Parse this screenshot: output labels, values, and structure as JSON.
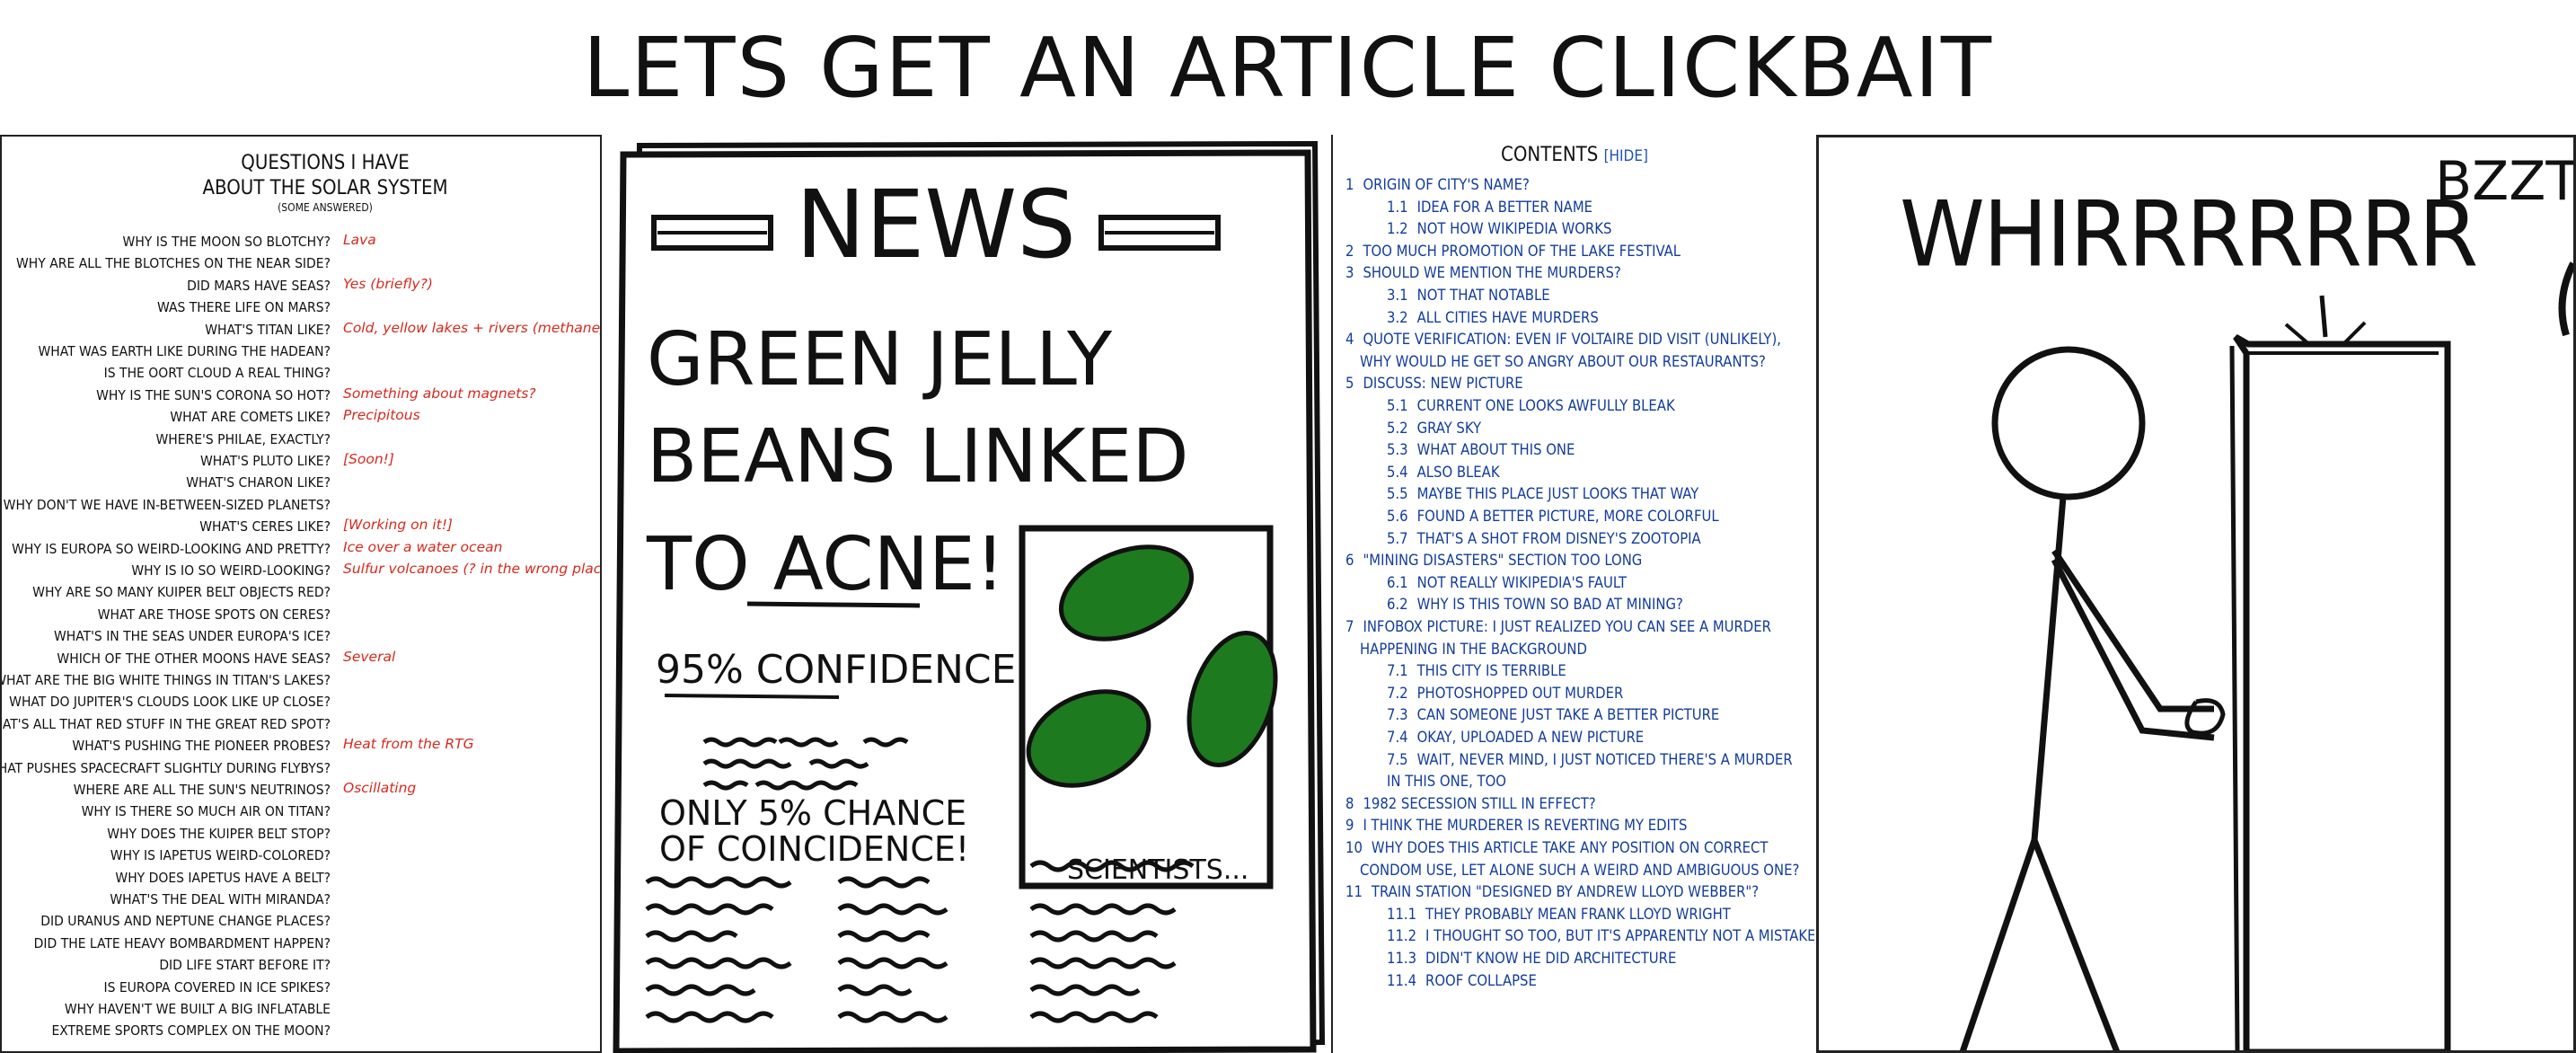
{
  "title": "LETS GET AN ARTICLE CLICKBAIT",
  "panel1": {
    "heading_line1": "QUESTIONS I HAVE",
    "heading_line2": "ABOUT THE SOLAR SYSTEM",
    "subheading": "(SOME ANSWERED)",
    "questions": [
      "WHY IS THE MOON SO BLOTCHY?",
      "WHY ARE ALL THE BLOTCHES ON THE NEAR SIDE?",
      "DID MARS HAVE SEAS?",
      "WAS THERE LIFE ON MARS?",
      "WHAT'S TITAN LIKE?",
      "WHAT WAS EARTH LIKE DURING THE HADEAN?",
      "IS THE OORT CLOUD A REAL THING?",
      "WHY IS THE SUN'S CORONA SO HOT?",
      "WHAT ARE COMETS LIKE?",
      "WHERE'S PHILAE, EXACTLY?",
      "WHAT'S PLUTO LIKE?",
      "WHAT'S CHARON LIKE?",
      "WHY DON'T WE HAVE IN-BETWEEN-SIZED PLANETS?",
      "WHAT'S CERES LIKE?",
      "WHY IS EUROPA SO WEIRD-LOOKING AND PRETTY?",
      "WHY IS IO SO WEIRD-LOOKING?",
      "WHY ARE SO MANY KUIPER BELT OBJECTS RED?",
      "WHAT ARE THOSE SPOTS ON CERES?",
      "WHAT'S IN THE SEAS UNDER EUROPA'S ICE?",
      "WHICH OF THE OTHER MOONS HAVE SEAS?",
      "WHAT ARE THE BIG WHITE THINGS IN TITAN'S LAKES?",
      "WHAT DO JUPITER'S CLOUDS LOOK LIKE UP CLOSE?",
      "WHAT'S ALL THAT RED STUFF IN THE GREAT RED SPOT?",
      "WHAT'S PUSHING THE PIONEER PROBES?",
      "WHAT PUSHES SPACECRAFT SLIGHTLY DURING FLYBYS?",
      "WHERE ARE ALL THE SUN'S NEUTRINOS?",
      "WHY IS THERE SO MUCH AIR ON TITAN?",
      "WHY DOES THE KUIPER BELT STOP?",
      "WHY IS IAPETUS WEIRD-COLORED?",
      "WHY DOES IAPETUS HAVE A BELT?",
      "WHAT'S THE DEAL WITH MIRANDA?",
      "DID URANUS AND NEPTUNE CHANGE PLACES?",
      "DID THE LATE HEAVY BOMBARDMENT HAPPEN?",
      "DID LIFE START BEFORE IT?",
      "IS EUROPA COVERED IN ICE SPIKES?",
      "WHY HAVEN'T WE BUILT A BIG INFLATABLE",
      "EXTREME SPORTS COMPLEX ON THE MOON?"
    ],
    "answers": [
      {
        "row": 0,
        "text": "Lava"
      },
      {
        "row": 2,
        "text": "Yes (briefly?)"
      },
      {
        "row": 4,
        "text": "Cold, yellow lakes + rivers (methane)"
      },
      {
        "row": 7,
        "text": "Something about magnets?"
      },
      {
        "row": 8,
        "text": "Precipitous"
      },
      {
        "row": 10,
        "text": "[Soon!]"
      },
      {
        "row": 13,
        "text": "[Working on it!]"
      },
      {
        "row": 14,
        "text": "Ice over a water ocean"
      },
      {
        "row": 15,
        "text": "Sulfur volcanoes (? in the wrong places?)"
      },
      {
        "row": 19,
        "text": "Several"
      },
      {
        "row": 23,
        "text": "Heat from the RTG"
      },
      {
        "row": 25,
        "text": "Oscillating"
      }
    ]
  },
  "panel2": {
    "masthead": "NEWS",
    "headline_line1": "GREEN JELLY",
    "headline_line2": "BEANS LINKED",
    "headline_line3": "TO ACNE!",
    "confidence": "95% CONFIDENCE",
    "chance_line1": "ONLY 5% CHANCE",
    "chance_line2": "OF COINCIDENCE!",
    "scientists": "SCIENTISTS...",
    "jellybean_color": "#1e7a1e"
  },
  "panel3": {
    "title": "CONTENTS",
    "hide_label": "[HIDE]",
    "entries": [
      {
        "num": "1",
        "text": "ORIGIN OF CITY'S NAME?",
        "level": 0
      },
      {
        "num": "1.1",
        "text": "IDEA FOR A BETTER NAME",
        "level": 1
      },
      {
        "num": "1.2",
        "text": "NOT HOW WIKIPEDIA WORKS",
        "level": 1
      },
      {
        "num": "2",
        "text": "TOO MUCH PROMOTION OF THE LAKE FESTIVAL",
        "level": 0
      },
      {
        "num": "3",
        "text": "SHOULD WE MENTION THE MURDERS?",
        "level": 0
      },
      {
        "num": "3.1",
        "text": "NOT THAT NOTABLE",
        "level": 1
      },
      {
        "num": "3.2",
        "text": "ALL CITIES HAVE MURDERS",
        "level": 1
      },
      {
        "num": "4",
        "text": "QUOTE VERIFICATION: EVEN IF VOLTAIRE DID VISIT (UNLIKELY),",
        "level": 0
      },
      {
        "num": "",
        "text": "WHY WOULD HE GET SO ANGRY ABOUT OUR RESTAURANTS?",
        "level": 0
      },
      {
        "num": "5",
        "text": "DISCUSS: NEW PICTURE",
        "level": 0
      },
      {
        "num": "5.1",
        "text": "CURRENT ONE LOOKS AWFULLY BLEAK",
        "level": 1
      },
      {
        "num": "5.2",
        "text": "GRAY SKY",
        "level": 1
      },
      {
        "num": "5.3",
        "text": "WHAT ABOUT THIS ONE",
        "level": 1
      },
      {
        "num": "5.4",
        "text": "ALSO BLEAK",
        "level": 1
      },
      {
        "num": "5.5",
        "text": "MAYBE THIS PLACE JUST LOOKS THAT WAY",
        "level": 1
      },
      {
        "num": "5.6",
        "text": "FOUND A BETTER PICTURE, MORE COLORFUL",
        "level": 1
      },
      {
        "num": "5.7",
        "text": "THAT'S A SHOT FROM DISNEY'S ZOOTOPIA",
        "level": 1
      },
      {
        "num": "6",
        "text": "\"MINING DISASTERS\" SECTION TOO LONG",
        "level": 0
      },
      {
        "num": "6.1",
        "text": "NOT REALLY WIKIPEDIA'S FAULT",
        "level": 1
      },
      {
        "num": "6.2",
        "text": "WHY IS THIS TOWN SO BAD AT MINING?",
        "level": 1
      },
      {
        "num": "7",
        "text": "INFOBOX PICTURE: I JUST REALIZED YOU CAN SEE A MURDER",
        "level": 0
      },
      {
        "num": "",
        "text": "HAPPENING IN THE BACKGROUND",
        "level": 0
      },
      {
        "num": "7.1",
        "text": "THIS CITY IS TERRIBLE",
        "level": 1
      },
      {
        "num": "7.2",
        "text": "PHOTOSHOPPED OUT MURDER",
        "level": 1
      },
      {
        "num": "7.3",
        "text": "CAN SOMEONE JUST TAKE A BETTER PICTURE",
        "level": 1
      },
      {
        "num": "7.4",
        "text": "OKAY, UPLOADED A NEW PICTURE",
        "level": 1
      },
      {
        "num": "7.5",
        "text": "WAIT, NEVER MIND, I JUST NOTICED THERE'S A MURDER",
        "level": 1
      },
      {
        "num": "",
        "text": "IN THIS ONE, TOO",
        "level": 1
      },
      {
        "num": "8",
        "text": "1982 SECESSION STILL IN EFFECT?",
        "level": 0
      },
      {
        "num": "9",
        "text": "I THINK THE MURDERER IS REVERTING MY EDITS",
        "level": 0
      },
      {
        "num": "10",
        "text": "WHY DOES THIS ARTICLE TAKE ANY POSITION ON CORRECT",
        "level": 0
      },
      {
        "num": "",
        "text": "CONDOM USE, LET ALONE SUCH A WEIRD AND AMBIGUOUS ONE?",
        "level": 0
      },
      {
        "num": "11",
        "text": "TRAIN STATION \"DESIGNED BY ANDREW LLOYD WEBBER\"?",
        "level": 0
      },
      {
        "num": "11.1",
        "text": "THEY PROBABLY MEAN FRANK LLOYD WRIGHT",
        "level": 1
      },
      {
        "num": "11.2",
        "text": "I THOUGHT SO TOO, BUT IT'S APPARENTLY NOT A MISTAKE",
        "level": 1
      },
      {
        "num": "11.3",
        "text": "DIDN'T KNOW HE DID ARCHITECTURE",
        "level": 1
      },
      {
        "num": "11.4",
        "text": "ROOF COLLAPSE",
        "level": 1
      }
    ]
  },
  "panel4": {
    "sound1": "WHIRRRRRRR",
    "sound2": "BZZT"
  }
}
